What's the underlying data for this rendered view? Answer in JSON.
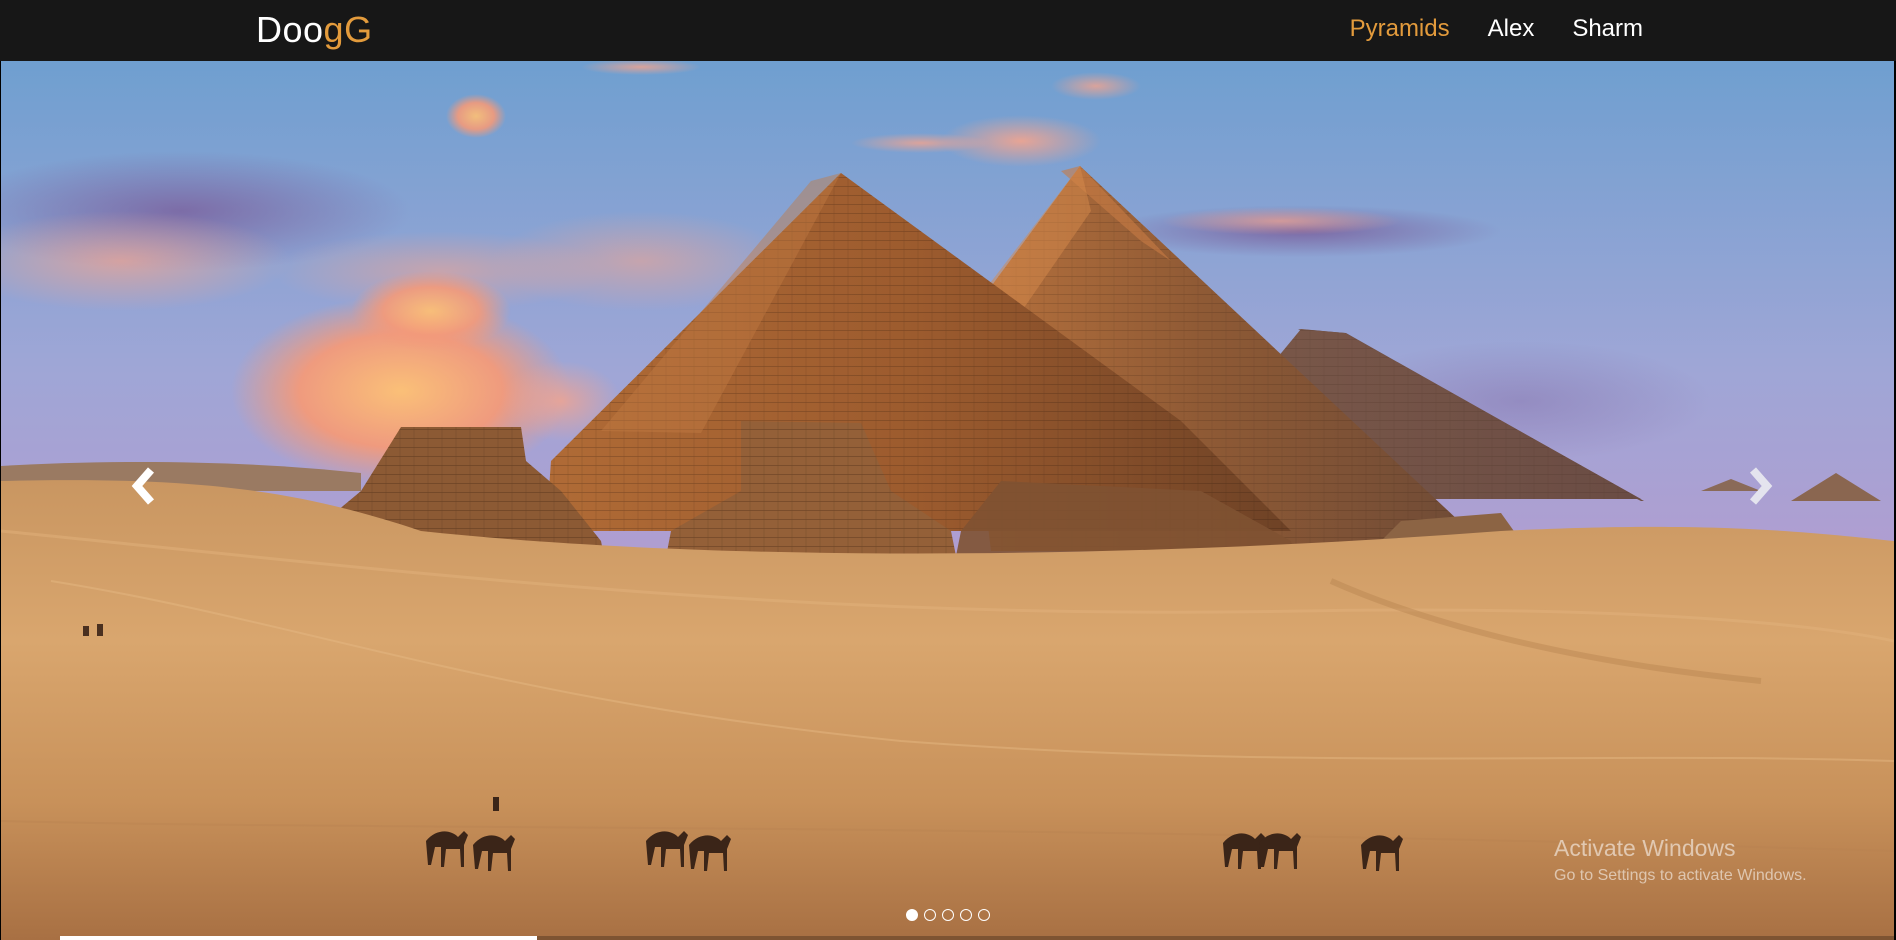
{
  "brand": {
    "prefix": "Doo",
    "accent": "gG"
  },
  "nav": {
    "items": [
      {
        "label": "Pyramids",
        "active": true
      },
      {
        "label": "Alex",
        "active": false
      },
      {
        "label": "Sharm",
        "active": false
      }
    ]
  },
  "carousel": {
    "slide_count": 5,
    "active_index": 0,
    "progress": 0.26,
    "controls": {
      "prev_icon": "chevron-left-icon",
      "next_icon": "chevron-right-icon"
    }
  },
  "watermark": {
    "title": "Activate Windows",
    "subtitle": "Go to Settings to activate Windows."
  },
  "colors": {
    "navbar_bg": "#171717",
    "accent": "#e39b3c",
    "text": "#ffffff"
  }
}
